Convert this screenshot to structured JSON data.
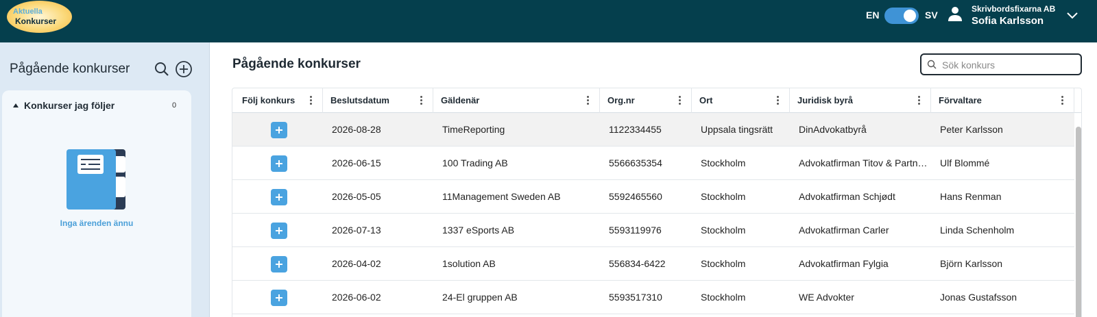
{
  "header": {
    "logo_line1": "Aktuella",
    "logo_line2": "Konkurser",
    "lang_left": "EN",
    "lang_right": "SV",
    "language_toggle_on": true,
    "company": "Skrivbordsfixarna AB",
    "user": "Sofia Karlsson",
    "icons": {
      "user": "user-icon",
      "menu": "chevron-down-icon"
    }
  },
  "sidebar": {
    "title": "Pågående konkurser",
    "followed_section": {
      "title": "Konkurser jag följer",
      "count": "0",
      "empty_text": "Inga ärenden ännu"
    },
    "icons": {
      "search": "search-icon",
      "add": "plus-circle-icon",
      "empty": "folder-document-icon"
    }
  },
  "main": {
    "title": "Pågående konkurser",
    "search": {
      "placeholder": "Sök konkurs",
      "value": ""
    },
    "table": {
      "columns": [
        "Följ konkurs",
        "Beslutsdatum",
        "Gäldenär",
        "Org.nr",
        "Ort",
        "Juridisk byrå",
        "Förvaltare"
      ],
      "rows": [
        {
          "date": "2026-08-28",
          "debtor": "TimeReporting",
          "org": "1122334455",
          "city": "Uppsala tingsrätt",
          "firm": "DinAdvokatbyrå",
          "admin": "Peter Karlsson"
        },
        {
          "date": "2026-06-15",
          "debtor": "100 Trading AB",
          "org": "5566635354",
          "city": "Stockholm",
          "firm": "Advokatfirman Titov & Partners",
          "admin": "Ulf Blommé"
        },
        {
          "date": "2026-05-05",
          "debtor": "11Management Sweden AB",
          "org": "5592465560",
          "city": "Stockholm",
          "firm": "Advokatfirman Schjødt",
          "admin": "Hans Renman"
        },
        {
          "date": "2026-07-13",
          "debtor": "1337 eSports AB",
          "org": "5593119976",
          "city": "Stockholm",
          "firm": "Advokatfirman Carler",
          "admin": "Linda Schenholm"
        },
        {
          "date": "2026-04-02",
          "debtor": "1solution AB",
          "org": "556834-6422",
          "city": "Stockholm",
          "firm": "Advokatfirman Fylgia",
          "admin": "Björn Karlsson"
        },
        {
          "date": "2026-06-02",
          "debtor": "24-El gruppen AB",
          "org": "5593517310",
          "city": "Stockholm",
          "firm": "WE Advokter",
          "admin": "Jonas Gustafsson"
        }
      ]
    }
  },
  "colors": {
    "topbar": "#053f4d",
    "accent": "#4aa3e0",
    "sidebar": "#dde9f4"
  }
}
